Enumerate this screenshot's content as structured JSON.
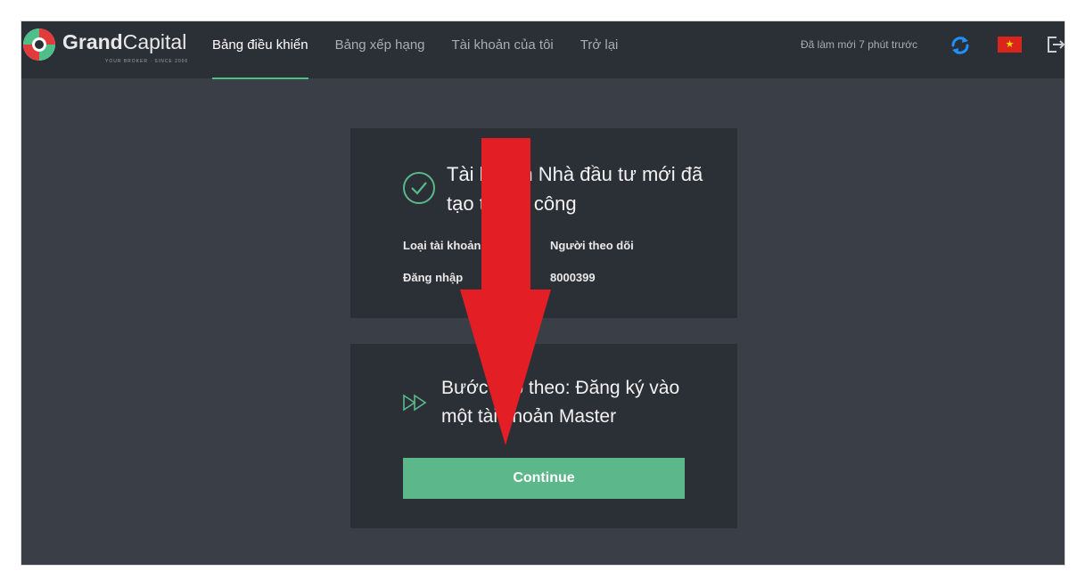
{
  "header": {
    "logo": {
      "brand_bold": "Grand",
      "brand_light": "Capital",
      "tagline": "YOUR BROKER · SINCE 2006"
    },
    "nav": [
      {
        "label": "Bảng điều khiển",
        "active": true
      },
      {
        "label": "Bảng xếp hạng",
        "active": false
      },
      {
        "label": "Tài khoản của tôi",
        "active": false
      },
      {
        "label": "Trở lại",
        "active": false
      }
    ],
    "refresh_status": "Đã làm mới 7 phút trước",
    "icons": {
      "refresh": "refresh-icon",
      "flag": "vietnam-flag-icon",
      "logout": "logout-icon"
    },
    "flag_star": "★"
  },
  "success_card": {
    "icon": "check-circle-icon",
    "title": "Tài khoản Nhà đầu tư mới đã tạo thành công",
    "rows": [
      {
        "label": "Loại tài khoản",
        "value": "Người theo dõi"
      },
      {
        "label": "Đăng nhập",
        "value": "8000399"
      }
    ]
  },
  "next_step_card": {
    "icon": "double-play-icon",
    "title": "Bước tiếp theo: Đăng ký vào một tài khoản Master",
    "button_label": "Continue"
  },
  "colors": {
    "accent": "#5cb88a",
    "overlay_arrow": "#e31e24",
    "refresh": "#1e90ff"
  }
}
